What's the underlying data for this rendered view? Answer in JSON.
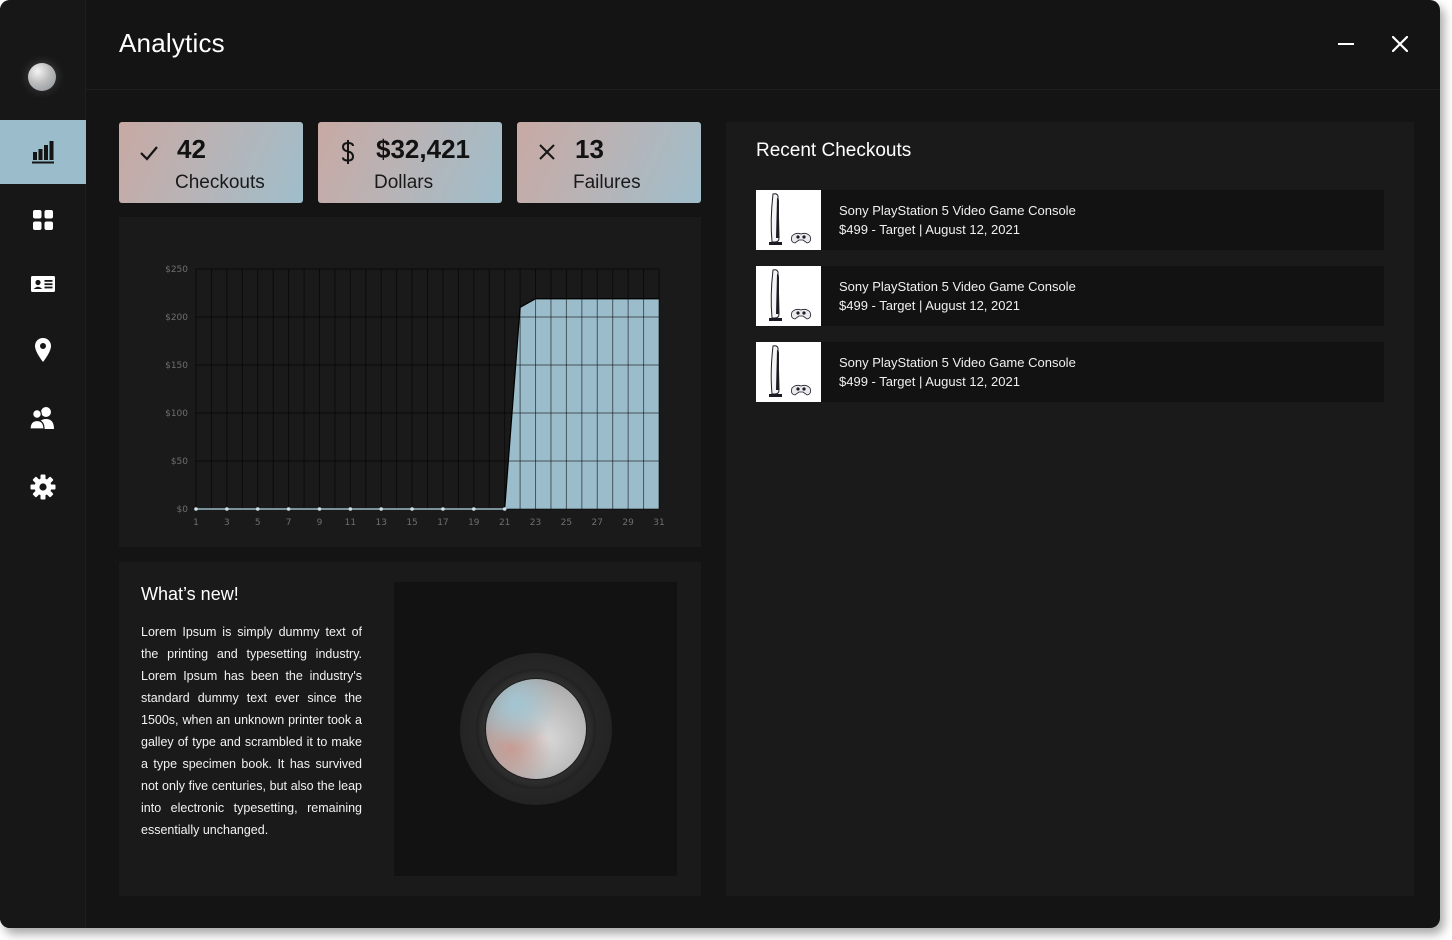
{
  "window": {
    "title": "Analytics"
  },
  "sidebar": {
    "items": [
      {
        "icon": "bar-chart-icon",
        "active": true
      },
      {
        "icon": "grid-icon",
        "active": false
      },
      {
        "icon": "id-card-icon",
        "active": false
      },
      {
        "icon": "map-pin-icon",
        "active": false
      },
      {
        "icon": "users-icon",
        "active": false
      },
      {
        "icon": "gear-icon",
        "active": false
      }
    ]
  },
  "stats": [
    {
      "icon": "check-icon",
      "value": "42",
      "label": "Checkouts"
    },
    {
      "icon": "dollar-icon",
      "value": "$32,421",
      "label": "Dollars"
    },
    {
      "icon": "x-icon",
      "value": "13",
      "label": "Failures"
    }
  ],
  "chart_data": {
    "type": "area",
    "x": [
      1,
      2,
      3,
      4,
      5,
      6,
      7,
      8,
      9,
      10,
      11,
      12,
      13,
      14,
      15,
      16,
      17,
      18,
      19,
      20,
      21,
      22,
      23,
      24,
      25,
      26,
      27,
      28,
      29,
      30,
      31
    ],
    "values": [
      0,
      0,
      0,
      0,
      0,
      0,
      0,
      0,
      0,
      0,
      0,
      0,
      0,
      0,
      0,
      0,
      0,
      0,
      0,
      0,
      0,
      210,
      219,
      219,
      219,
      219,
      219,
      219,
      219,
      219,
      219
    ],
    "xticks": [
      "1",
      "3",
      "5",
      "7",
      "9",
      "11",
      "13",
      "15",
      "17",
      "19",
      "21",
      "23",
      "25",
      "27",
      "29",
      "31"
    ],
    "yticks": [
      "$0",
      "$50",
      "$100",
      "$150",
      "$200",
      "$250"
    ],
    "ylim": [
      0,
      250
    ],
    "grid": true,
    "fill_color": "#9bbcca"
  },
  "news": {
    "title": "What’s new!",
    "body": "Lorem Ipsum is simply dummy text of the printing and typesetting industry. Lorem Ipsum has been the industry's standard dummy text ever since the 1500s, when an unknown printer took a galley of type and scrambled it to make a type specimen book. It has survived not only five centuries, but also the leap into electronic typesetting, remaining essentially unchanged."
  },
  "recent": {
    "title": "Recent Checkouts",
    "items": [
      {
        "name": "Sony PlayStation 5 Video Game Console",
        "meta": "$499 - Target | August 12, 2021"
      },
      {
        "name": "Sony PlayStation 5 Video Game Console",
        "meta": "$499 - Target | August 12, 2021"
      },
      {
        "name": "Sony PlayStation 5 Video Game Console",
        "meta": "$499 - Target | August 12, 2021"
      }
    ]
  },
  "colors": {
    "accent": "#9bbcca",
    "card_gradient_start": "#c8a9a3",
    "card_gradient_end": "#9fbecb",
    "background": "#141414"
  }
}
